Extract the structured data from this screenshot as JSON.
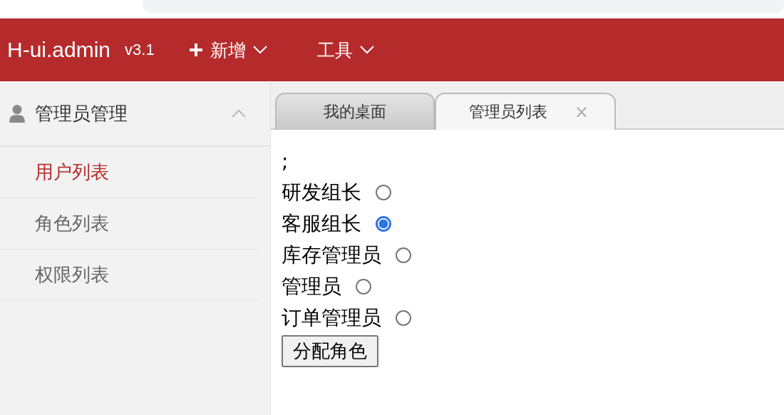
{
  "header": {
    "logo": "H-ui.admin",
    "version": "v3.1",
    "menus": [
      {
        "label": "新增",
        "kind": "add"
      },
      {
        "label": "工具",
        "kind": "plain"
      }
    ]
  },
  "sidebar": {
    "group": {
      "title": "管理员管理",
      "expanded": true
    },
    "items": [
      {
        "label": "用户列表",
        "selected": true
      },
      {
        "label": "角色列表",
        "selected": false
      },
      {
        "label": "权限列表",
        "selected": false
      }
    ]
  },
  "tabs": [
    {
      "label": "我的桌面",
      "selected": false
    },
    {
      "label": "管理员列表",
      "selected": true,
      "close": "×"
    }
  ],
  "content": {
    "prefix": ";",
    "roles": [
      {
        "label": "研发组长",
        "selected": false
      },
      {
        "label": "客服组长",
        "selected": true
      },
      {
        "label": "库存管理员",
        "selected": false
      },
      {
        "label": "管理员",
        "selected": false
      },
      {
        "label": "订单管理员",
        "selected": false
      }
    ],
    "button": "分配角色"
  }
}
